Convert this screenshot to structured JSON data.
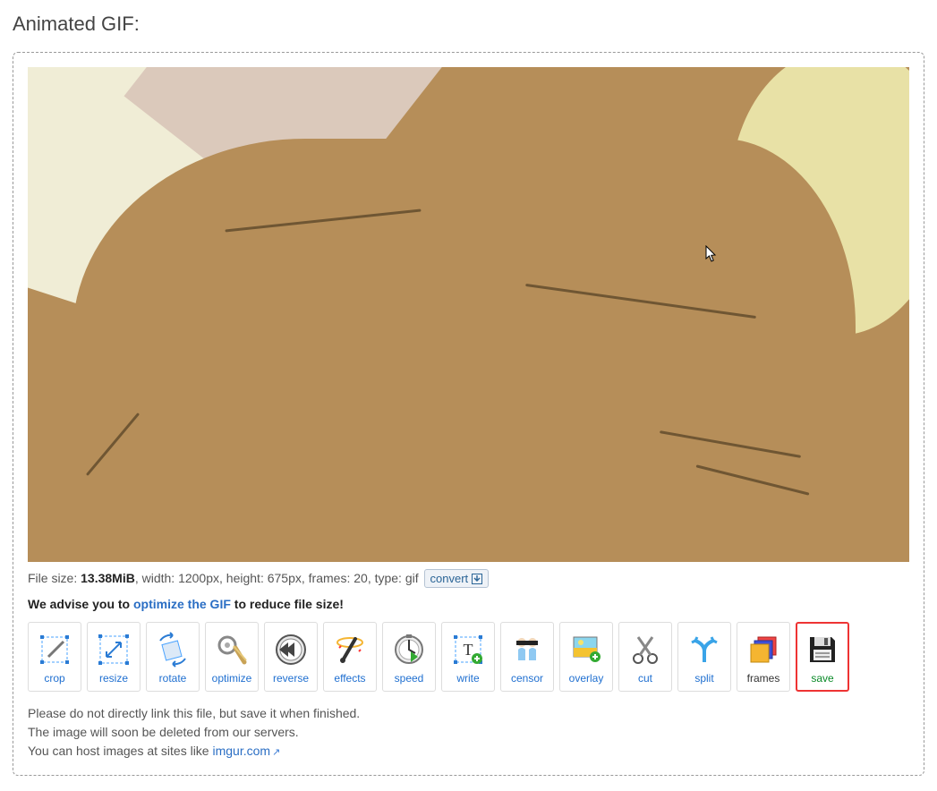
{
  "title": "Animated GIF:",
  "file": {
    "size_label": "File size: ",
    "size_value": "13.38MiB",
    "width_label": ", width: ",
    "width_value": "1200px",
    "height_label": ", height: ",
    "height_value": "675px",
    "frames_label": ", frames: ",
    "frames_value": "20",
    "type_label": ", type: ",
    "type_value": "gif",
    "convert_label": "convert"
  },
  "advice": {
    "prefix": "We advise you to ",
    "link": "optimize the GIF",
    "suffix": " to reduce file size!"
  },
  "tools": {
    "crop": "crop",
    "resize": "resize",
    "rotate": "rotate",
    "optimize": "optimize",
    "reverse": "reverse",
    "effects": "effects",
    "speed": "speed",
    "write": "write",
    "censor": "censor",
    "overlay": "overlay",
    "cut": "cut",
    "split": "split",
    "frames": "frames",
    "save": "save"
  },
  "notes": {
    "line1": "Please do not directly link this file, but save it when finished.",
    "line2": "The image will soon be deleted from our servers.",
    "line3_prefix": "You can host images at sites like ",
    "line3_link": "imgur.com"
  }
}
